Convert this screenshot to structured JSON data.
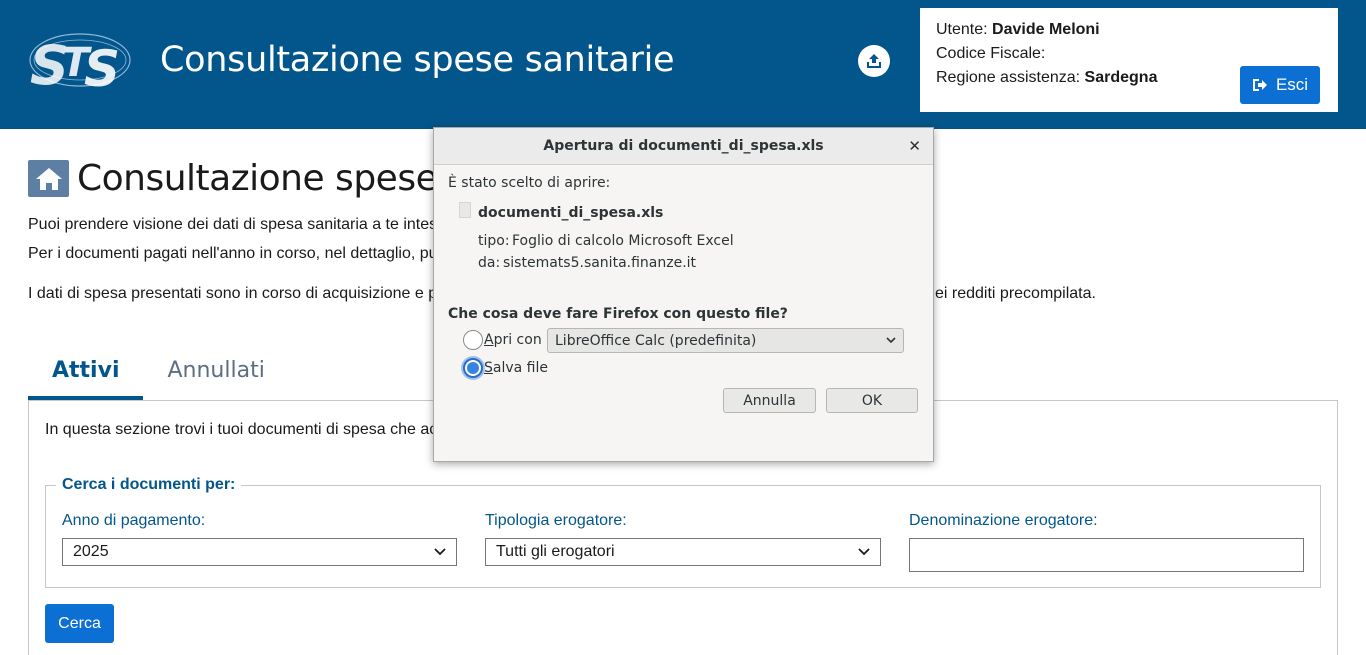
{
  "header": {
    "title": "Consultazione spese sanitarie",
    "logo_text": "STS",
    "user_label": "Utente:",
    "user_name": "Davide Meloni",
    "fiscal_code_label": "Codice Fiscale:",
    "region_label": "Regione assistenza:",
    "region_value": "Sardegna",
    "logout_label": "Esci"
  },
  "page": {
    "title": "Consultazione spese sa",
    "intro_line1": "Puoi prendere visione dei dati di spesa sanitaria a te intes",
    "intro_line2": "Per i documenti pagati nell'anno in corso, nel dettaglio, pu",
    "intro_line3_start": "I dati di spesa presentati sono in corso di acquisizione e p",
    "intro_line3_end": "ei redditi precompilata."
  },
  "tabs": [
    {
      "label": "Attivi",
      "active": true
    },
    {
      "label": "Annullati",
      "active": false
    }
  ],
  "panel": {
    "description": "In questa sezione trovi i tuoi documenti di spesa che ac",
    "legend": "Cerca i documenti per:",
    "year_label": "Anno di pagamento:",
    "year_value": "2025",
    "provider_type_label": "Tipologia erogatore:",
    "provider_type_value": "Tutti gli erogatori",
    "provider_name_label": "Denominazione erogatore:",
    "provider_name_value": "",
    "search_label": "Cerca"
  },
  "dialog": {
    "title": "Apertura di documenti_di_spesa.xls",
    "chosen_label": "È stato scelto di aprire:",
    "filename": "documenti_di_spesa.xls",
    "type_label": "tipo:",
    "type_value": "Foglio di calcolo Microsoft Excel",
    "from_label": "da:",
    "from_value": "sistemats5.sanita.finanze.it",
    "question": "Che cosa deve fare Firefox con questo file?",
    "open_with_first": "A",
    "open_with_rest": "pri con",
    "open_with_app": "LibreOffice Calc (predefinita)",
    "save_first": "S",
    "save_rest": "alva file",
    "selected_option": "save",
    "cancel_label": "Annulla",
    "ok_label": "OK"
  },
  "colors": {
    "header_bg": "#03568b",
    "primary_button": "#0b6fd4",
    "accent_text": "#03568b"
  }
}
